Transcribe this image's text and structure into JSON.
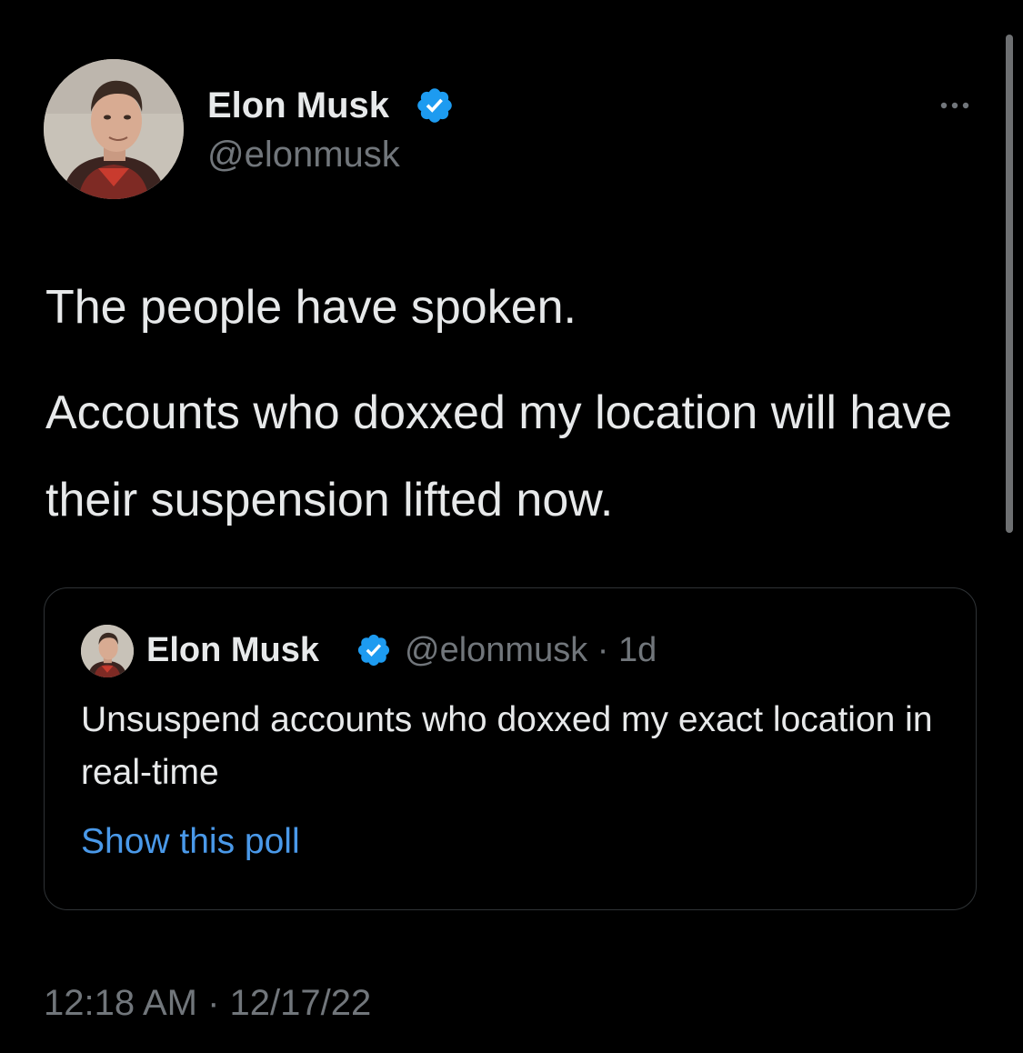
{
  "tweet": {
    "author": {
      "name": "Elon Musk",
      "handle": "@elonmusk",
      "verified": true,
      "avatar_icon": "profile-photo"
    },
    "text_paragraphs": [
      "The people have spoken.",
      "Accounts who doxxed my location will have their suspension lifted now."
    ],
    "timestamp": "12:18 AM · 12/17/22",
    "more_icon": "more-horizontal-icon"
  },
  "quote": {
    "author": {
      "name": "Elon Musk",
      "handle_meta": "@elonmusk · 1d",
      "verified": true
    },
    "text": "Unsuspend accounts who doxxed my exact location in real-time",
    "poll_link": "Show this poll"
  },
  "colors": {
    "background": "#000000",
    "primary_text": "#e7e9ea",
    "secondary_text": "#71767b",
    "link": "#4a99e9",
    "verified_badge": "#1d9bf0",
    "border": "#2f3336"
  }
}
